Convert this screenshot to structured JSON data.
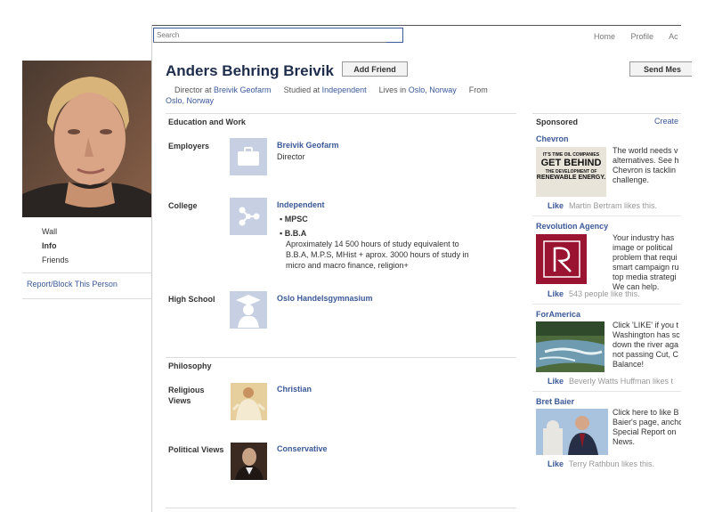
{
  "search": {
    "placeholder": "Search"
  },
  "topnav": [
    "Home",
    "Profile",
    "Ac"
  ],
  "profile": {
    "name": "Anders Behring Breivik",
    "add_friend": "Add Friend",
    "send_message": "Send Mes",
    "bio": {
      "director_at": "Director at",
      "employer": "Breivik Geofarm",
      "studied_at": "Studied at",
      "college": "Independent",
      "lives_in": "Lives in",
      "city": "Oslo, Norway",
      "from": "From",
      "hometown": "Oslo, Norway"
    }
  },
  "left_nav": {
    "wall": "Wall",
    "info": "Info",
    "friends": "Friends",
    "report": "Report/Block This Person"
  },
  "education": {
    "title": "Education and Work",
    "employers_label": "Employers",
    "employer_name": "Breivik Geofarm",
    "employer_role": "Director",
    "college_label": "College",
    "college_name": "Independent",
    "concentrations": [
      "MPSC",
      "B.B.A"
    ],
    "college_desc": [
      "Aproximately 14 500 hours of study equivalent to",
      "B.B.A, M.P.S, MHist + aprox. 3000 hours of study in",
      "micro and macro finance, religion+"
    ],
    "high_school_label": "High School",
    "high_school_name": "Oslo Handelsgymnasium"
  },
  "philosophy": {
    "title": "Philosophy",
    "religious_label": [
      "Religious",
      "Views"
    ],
    "religious_value": "Christian",
    "political_label": "Political Views",
    "political_value": "Conservative"
  },
  "sidebar": {
    "title": "Sponsored",
    "create": "Create",
    "like": "Like",
    "ads": [
      {
        "title": "Chevron",
        "image_text": [
          "IT'S TIME OIL COMPANIES",
          "GET BEHIND",
          "THE DEVELOPMENT OF",
          "RENEWABLE ENERGY."
        ],
        "text": [
          "The world needs v",
          "alternatives. See h",
          "Chevron is tacklin",
          "challenge."
        ],
        "likes": "Martin Bertram likes this."
      },
      {
        "title": "Revolution Agency",
        "text": [
          "Your industry has",
          "image or political",
          "problem that requi",
          "smart campaign ru",
          "top media strategi",
          "We can help."
        ],
        "likes": "543 people like this."
      },
      {
        "title": "ForAmerica",
        "text": [
          "Click 'LIKE' if you t",
          "Washington has sc",
          "down the river aga",
          "not passing Cut, C",
          "Balance!"
        ],
        "likes": "Beverly Watts Huffman likes t"
      },
      {
        "title": "Bret Baier",
        "text": [
          "Click here to like B",
          "Baier's page, ancho",
          "Special Report on",
          "News."
        ],
        "likes": "Terry Rathbun likes this."
      }
    ]
  },
  "colors": {
    "link": "#3b5998",
    "thumb_bg": "#c6d0e2"
  }
}
